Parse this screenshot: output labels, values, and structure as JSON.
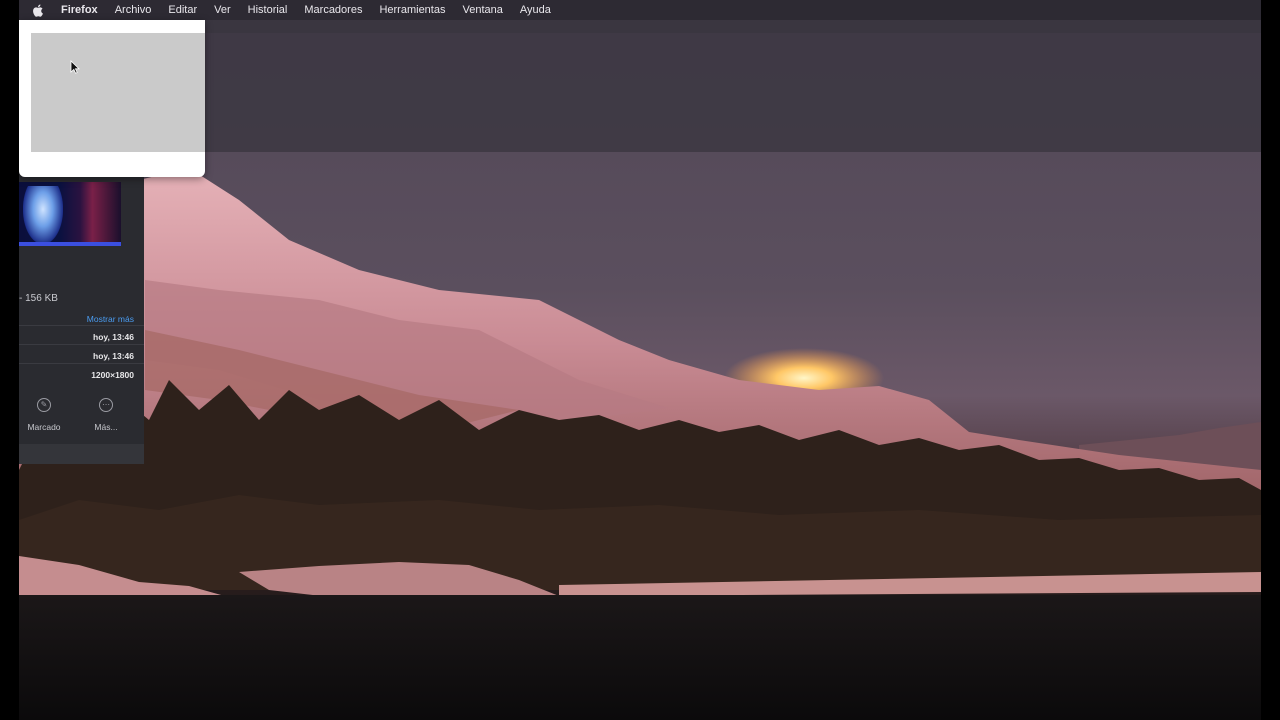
{
  "menubar": {
    "apple_icon": "apple-icon",
    "items": [
      "Firefox",
      "Archivo",
      "Editar",
      "Ver",
      "Historial",
      "Marcadores",
      "Herramientas",
      "Ventana",
      "Ayuda"
    ]
  },
  "info_panel": {
    "size": "- 156 KB",
    "show_more": "Mostrar más",
    "rows": [
      "hoy, 13:46",
      "hoy, 13:46",
      "1200×1800"
    ],
    "actions": [
      {
        "label": "Marcado",
        "icon": "markup-icon"
      },
      {
        "label": "Más...",
        "icon": "more-icon"
      }
    ]
  },
  "colors": {
    "menubar_bg": "#2d2a33",
    "panel_bg": "#2a2b30",
    "link": "#4a9cf0"
  }
}
